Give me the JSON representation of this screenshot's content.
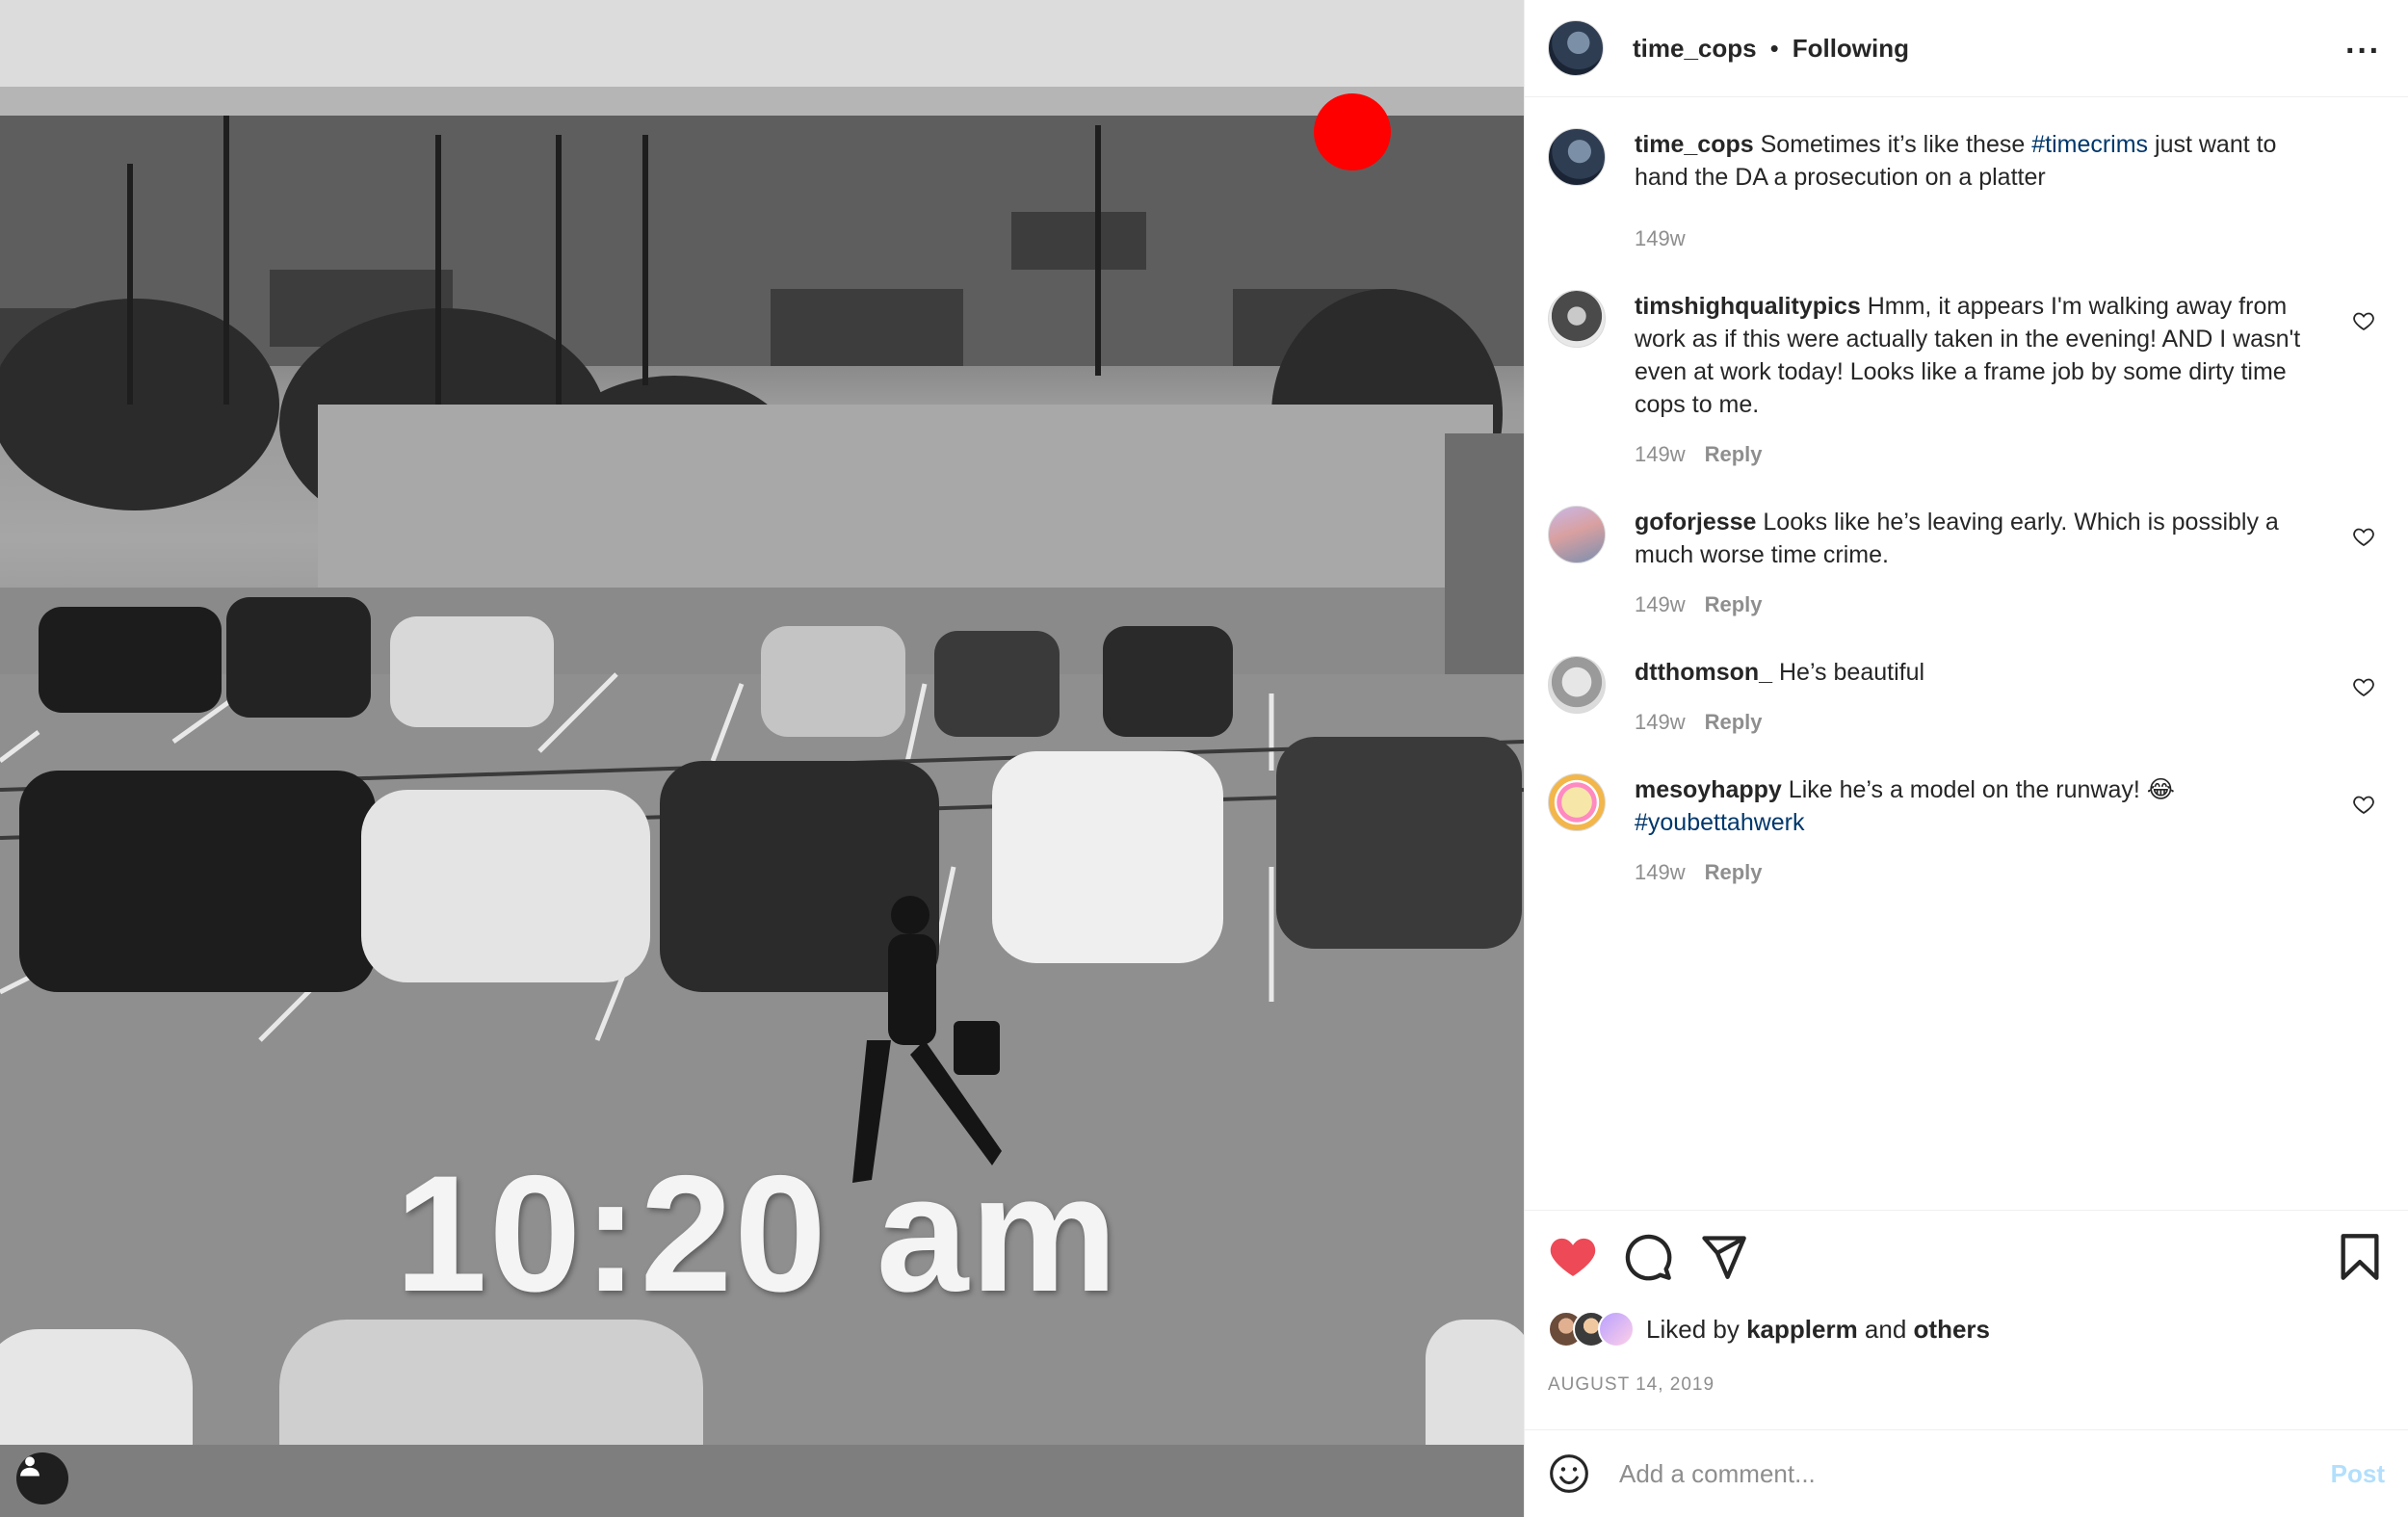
{
  "photo": {
    "overlay_time": "10:20 am",
    "accent_red": "#ff0000"
  },
  "header": {
    "username": "time_cops",
    "separator": "•",
    "follow_status": "Following",
    "more_icon": "more-horizontal-icon"
  },
  "caption": {
    "username": "time_cops",
    "text_before": "Sometimes it’s like these ",
    "hashtag": "#timecrims",
    "text_after": " just want to hand the DA a prosecution on a platter",
    "age": "149w"
  },
  "comments": [
    {
      "username": "timshighqualitypics",
      "text": "Hmm, it appears I'm walking away from work as if this were actually taken in the evening! AND I wasn't even at work today! Looks like a frame job by some dirty time cops to me.",
      "age": "149w",
      "reply": "Reply"
    },
    {
      "username": "goforjesse",
      "text": "Looks like he’s leaving early. Which is possibly a much worse time crime.",
      "age": "149w",
      "reply": "Reply"
    },
    {
      "username": "dtthomson_",
      "text": "He’s beautiful",
      "age": "149w",
      "reply": "Reply"
    },
    {
      "username": "mesoyhappy",
      "text": "Like he’s a model on the runway! 😂",
      "hashtag": "#youbettahwerk",
      "age": "149w",
      "reply": "Reply"
    }
  ],
  "actions": {
    "like_color": "#ed4956",
    "liked_by_prefix": "Liked by",
    "liked_by_user": "kapplerm",
    "liked_by_and": "and",
    "liked_by_others": "others",
    "date": "AUGUST 14, 2019"
  },
  "add_comment": {
    "placeholder": "Add a comment...",
    "post_label": "Post"
  }
}
